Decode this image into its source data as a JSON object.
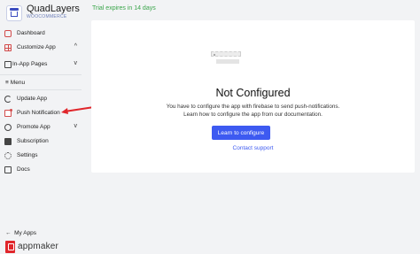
{
  "brand": {
    "name": "QuadLayers",
    "subtitle": "WOOCOMMERCE",
    "logo_icon": "cart-icon"
  },
  "trial_notice": "Trial expires in 14 days",
  "sidebar": {
    "items_top": [
      {
        "label": "Dashboard",
        "icon": "dashboard-icon"
      },
      {
        "label": "Customize App",
        "icon": "grid-icon",
        "chevron": "^"
      },
      {
        "label": "In-App Pages",
        "icon": "page-icon",
        "chevron": "v"
      }
    ],
    "menu_label": "Menu",
    "items": [
      {
        "label": "Update App",
        "icon": "refresh-icon"
      },
      {
        "label": "Push Notification",
        "icon": "push-icon"
      },
      {
        "label": "Promote App",
        "icon": "promote-icon",
        "chevron": "v"
      },
      {
        "label": "Subscription",
        "icon": "subscription-icon"
      },
      {
        "label": "Settings",
        "icon": "gear-icon"
      },
      {
        "label": "Docs",
        "icon": "docs-icon"
      }
    ],
    "my_apps": "My Apps",
    "footer_logo": "appmaker"
  },
  "main": {
    "title": "Not Configured",
    "description_line1": "You have to configure the app with firebase to send push-notifications.",
    "description_line2": "Learn how to configure the app from our documentation.",
    "primary_button": "Learn to configure",
    "support_link": "Contact support"
  },
  "colors": {
    "accent": "#3d5af1",
    "trial_green": "#3aa54a",
    "annotation_arrow": "#e0262b",
    "brand_red": "#e0262b"
  }
}
